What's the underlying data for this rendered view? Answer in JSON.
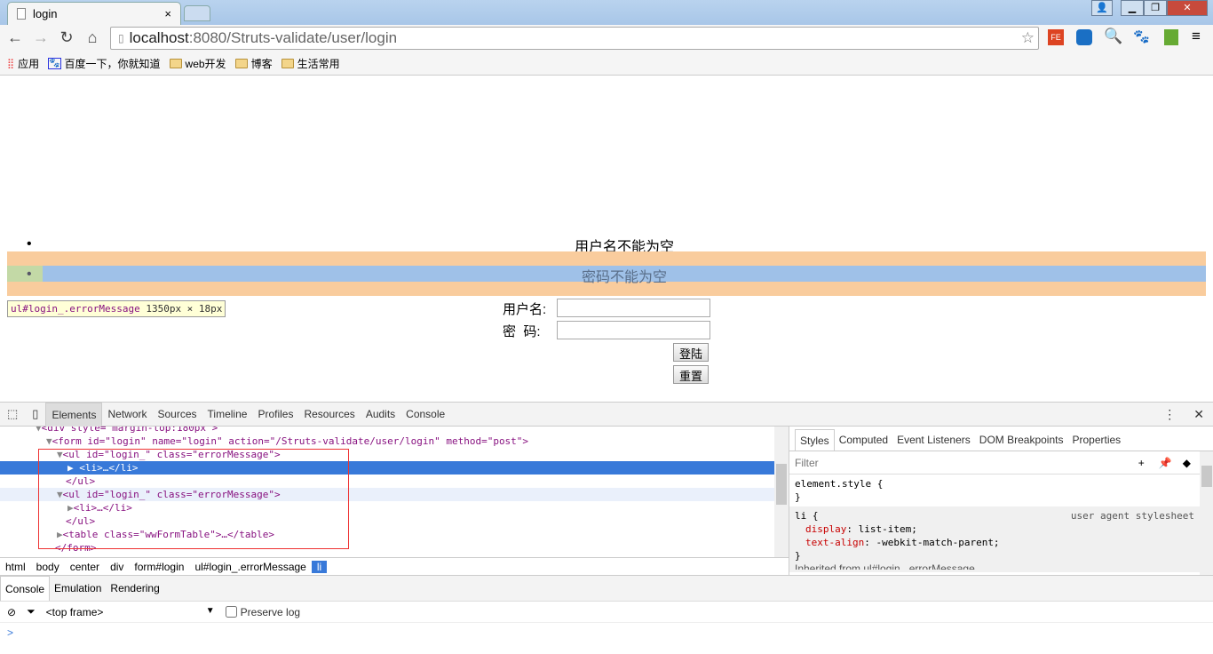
{
  "browser": {
    "tab_title": "login",
    "url_host": "localhost",
    "url_rest": ":8080/Struts-validate/user/login"
  },
  "bookmarks": [
    {
      "label": "应用",
      "icon": "apps-icon"
    },
    {
      "label": "百度一下，你就知道",
      "icon": "baidu-paw-icon"
    },
    {
      "label": "web开发",
      "icon": "folder-icon"
    },
    {
      "label": "博客",
      "icon": "folder-icon"
    },
    {
      "label": "生活常用",
      "icon": "folder-icon"
    }
  ],
  "page": {
    "errors": [
      "用户名不能为空",
      "密码不能为空"
    ],
    "username_label": "用户名:",
    "password_label": "密  码:",
    "username_value": "",
    "password_value": "",
    "login_button": "登陆",
    "reset_button": "重置",
    "tooltip_selector": "ul#login_.errorMessage",
    "tooltip_size": "1350px × 18px"
  },
  "highlight_colors": {
    "margin": "#f9cc9d",
    "padding": "#c3d9a6",
    "content": "#9fc1e8"
  },
  "devtools": {
    "tabs": [
      "Elements",
      "Network",
      "Sources",
      "Timeline",
      "Profiles",
      "Resources",
      "Audits",
      "Console"
    ],
    "dom_lines": [
      "<div style=\"margin-top:180px\">",
      "<form id=\"login\" name=\"login\" action=\"/Struts-validate/user/login\" method=\"post\">",
      "<ul id=\"login_\" class=\"errorMessage\">",
      "<li>…</li>",
      "</ul>",
      "<ul id=\"login_\" class=\"errorMessage\">",
      "<li>…</li>",
      "</ul>",
      "<table class=\"wwFormTable\">…</table>",
      "</form>"
    ],
    "breadcrumbs": [
      "html",
      "body",
      "center",
      "div",
      "form#login",
      "ul#login_.errorMessage",
      "li"
    ],
    "side_tabs": [
      "Styles",
      "Computed",
      "Event Listeners",
      "DOM Breakpoints",
      "Properties"
    ],
    "filter_placeholder": "Filter",
    "styles": {
      "element_style": "element.style {",
      "close": "}",
      "li_selector": "li {",
      "li_source": "user agent stylesheet",
      "p1_name": "display",
      "p1_value": "list-item;",
      "p2_name": "text-align",
      "p2_value": "-webkit-match-parent;",
      "inherited": "Inherited from ul#login_.errorMessage"
    },
    "drawer_tabs": [
      "Console",
      "Emulation",
      "Rendering"
    ],
    "frame": "<top frame>",
    "preserve_log": "Preserve log",
    "prompt": ">"
  }
}
